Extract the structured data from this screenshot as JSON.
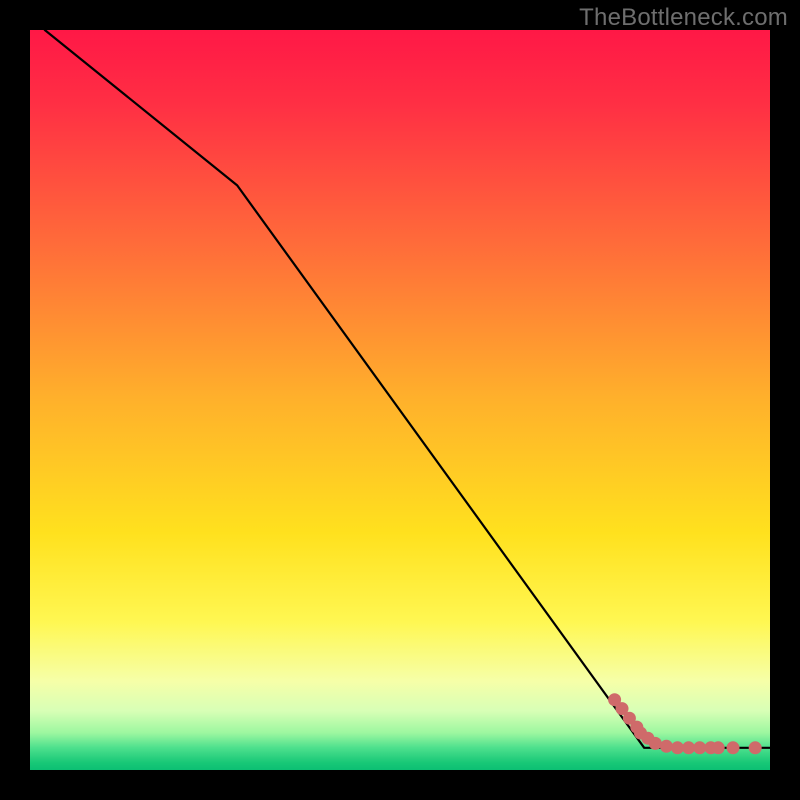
{
  "watermark": "TheBottleneck.com",
  "colors": {
    "background": "#000000",
    "line": "#000000",
    "marker_fill": "#cf6a6a",
    "marker_stroke": "#b85555",
    "gradient_top": "#ff1846",
    "gradient_bottom": "#0cbf73"
  },
  "chart_data": {
    "type": "line",
    "title": "",
    "xlabel": "",
    "ylabel": "",
    "xlim": [
      0,
      100
    ],
    "ylim": [
      0,
      100
    ],
    "grid": false,
    "annotations": [
      "TheBottleneck.com"
    ],
    "series": [
      {
        "name": "bottleneck-curve",
        "x": [
          2,
          28,
          83,
          100
        ],
        "y": [
          100,
          79,
          3,
          3
        ],
        "style": "line"
      },
      {
        "name": "bottleneck-markers",
        "x": [
          79,
          80,
          81,
          82,
          82.5,
          83.5,
          84.5,
          86,
          87.5,
          89,
          90.5,
          92,
          93,
          95,
          98
        ],
        "y": [
          9.5,
          8.3,
          7.0,
          5.8,
          5.0,
          4.3,
          3.6,
          3.2,
          3.0,
          3.0,
          3.0,
          3.0,
          3.0,
          3.0,
          3.0
        ],
        "style": "markers"
      }
    ]
  }
}
